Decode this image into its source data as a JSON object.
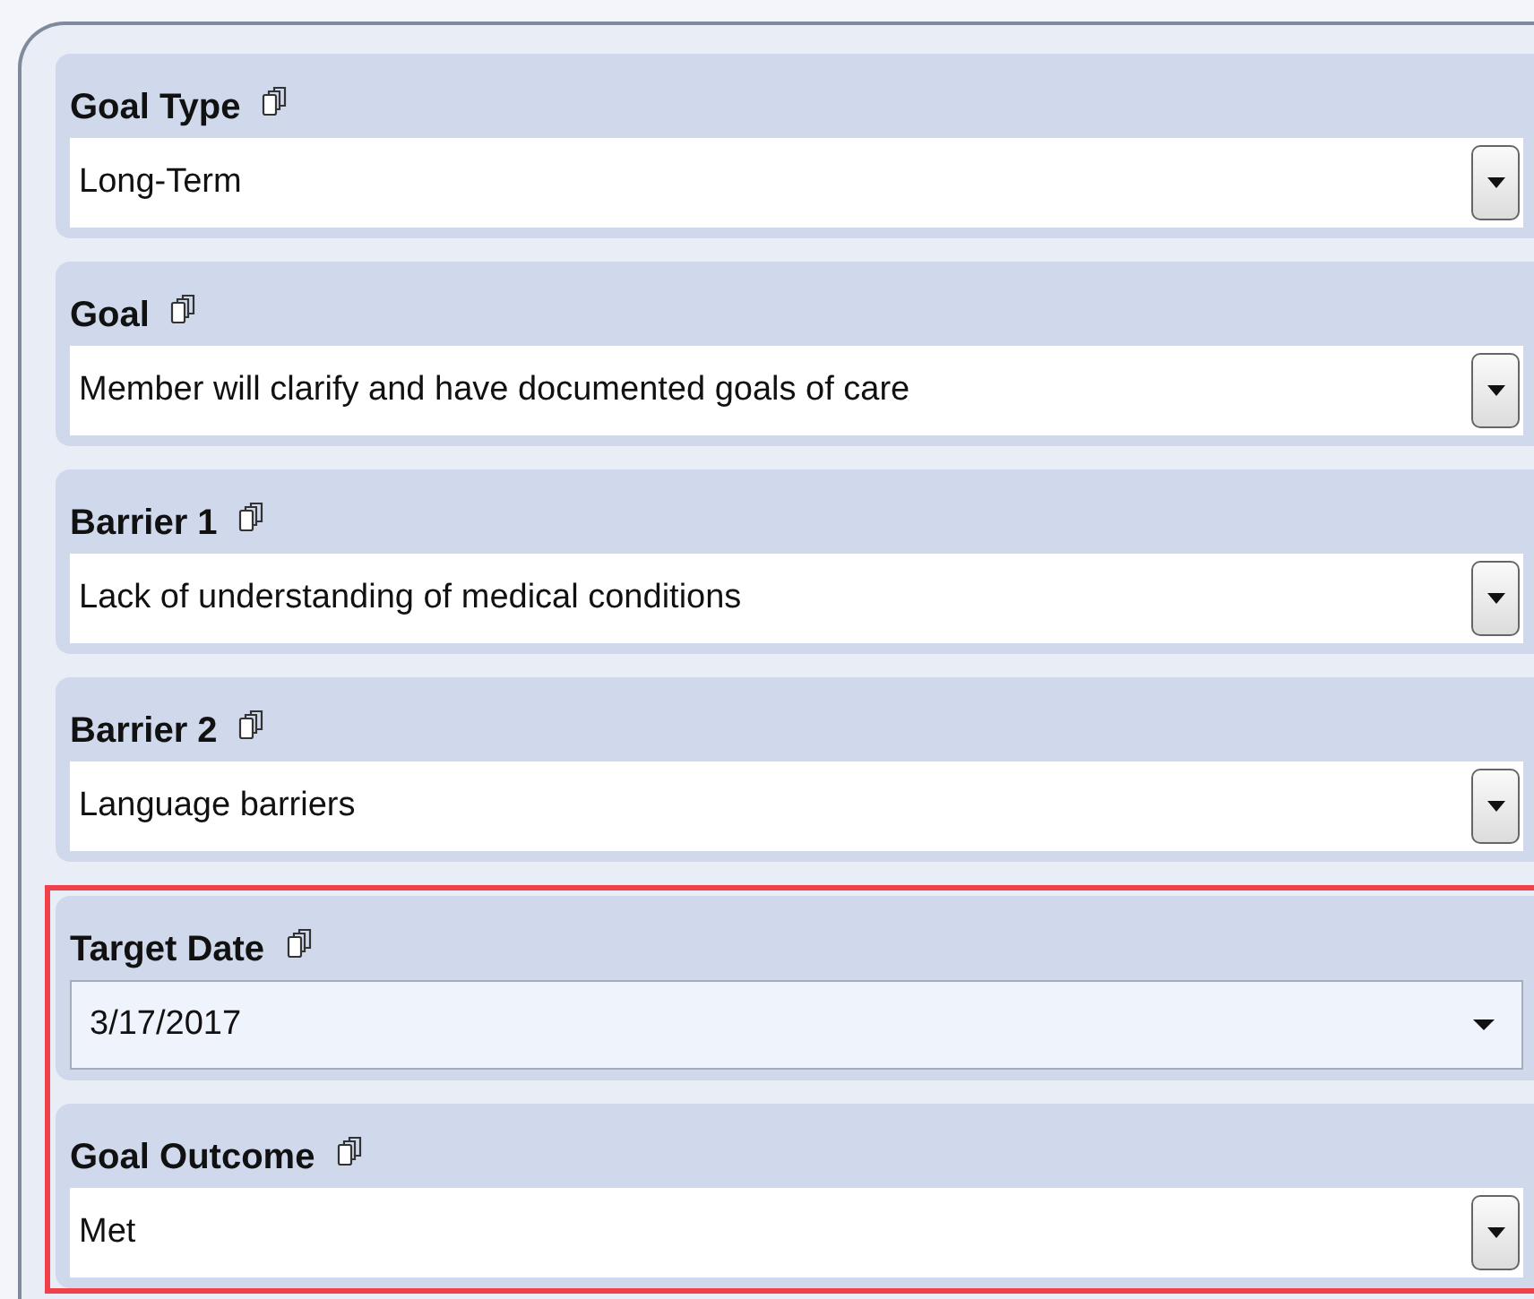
{
  "groups": [
    {
      "highlighted": false,
      "fields": [
        {
          "label": "Goal Type",
          "kind": "combobox",
          "value": "Long-Term"
        },
        {
          "label": "Goal",
          "kind": "combobox",
          "value": "Member will clarify and have documented goals of care"
        },
        {
          "label": "Barrier 1",
          "kind": "combobox",
          "value": "Lack of understanding of medical conditions"
        },
        {
          "label": "Barrier 2",
          "kind": "combobox",
          "value": "Language barriers"
        }
      ]
    },
    {
      "highlighted": true,
      "fields": [
        {
          "label": "Target Date",
          "kind": "datepicker",
          "value": "3/17/2017"
        },
        {
          "label": "Goal Outcome",
          "kind": "combobox",
          "value": "Met"
        }
      ]
    }
  ]
}
